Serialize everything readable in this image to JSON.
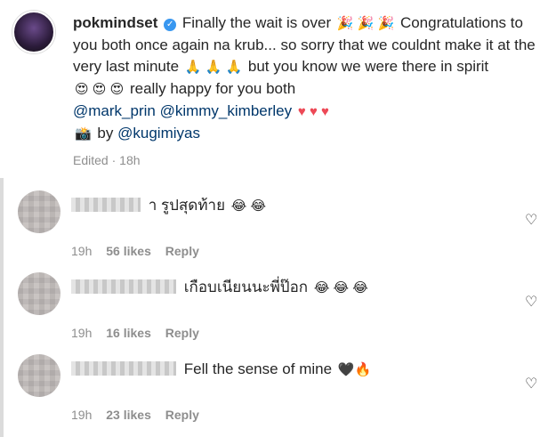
{
  "post": {
    "username": "pokmindset",
    "verified_icon": "✓",
    "segments": {
      "s1": "Finally the wait is over",
      "e1": "🎉 🎉 🎉",
      "s2": "Congratulations to you both once again na krub... so sorry that we couldnt make it at the very last minute",
      "e2": "🙏 🙏 🙏",
      "s3": "but you know we were there in spirit",
      "e3": "😍 😍 😍",
      "s4": "really happy for you both"
    },
    "mentions": [
      "@mark_prin",
      "@kimmy_kimberley"
    ],
    "hearts": "♥ ♥ ♥",
    "camera_icon": "📸",
    "credit_by": "by",
    "credit_mention": "@kugimiyas",
    "edited_label": "Edited",
    "edited_sep": "·",
    "edited_time": "18h"
  },
  "comments": [
    {
      "text": "า รูปสุดท้าย",
      "emoji": "😂 😂",
      "time": "19h",
      "likes": "56 likes",
      "reply": "Reply"
    },
    {
      "text": "เกือบเนียนนะพี่ป๊อก",
      "emoji": "😂 😂 😂",
      "time": "19h",
      "likes": "16 likes",
      "reply": "Reply"
    },
    {
      "text": "Fell the sense of mine",
      "emoji": "🖤🔥",
      "time": "19h",
      "likes": "23 likes",
      "reply": "Reply"
    }
  ],
  "icons": {
    "like": "heart-outline-icon"
  },
  "colors": {
    "mention": "#00376b",
    "heart": "#ed4956",
    "muted": "#8e8e8e",
    "verified": "#3897f0"
  }
}
